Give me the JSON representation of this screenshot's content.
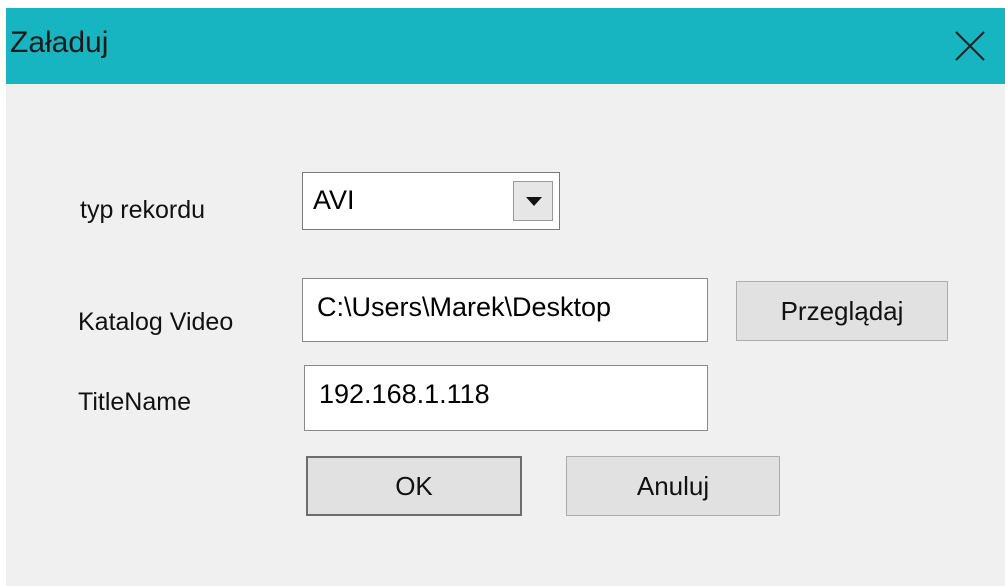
{
  "window": {
    "title": "Załaduj",
    "close_icon": "close-icon"
  },
  "form": {
    "record_type": {
      "label": "typ rekordu",
      "value": "AVI"
    },
    "video_dir": {
      "label": "Katalog Video",
      "value": "C:\\Users\\Marek\\Desktop",
      "browse_label": "Przeglądaj"
    },
    "title_name": {
      "label": "TitleName",
      "value": "192.168.1.118"
    }
  },
  "buttons": {
    "ok": "OK",
    "cancel": "Anuluj"
  }
}
